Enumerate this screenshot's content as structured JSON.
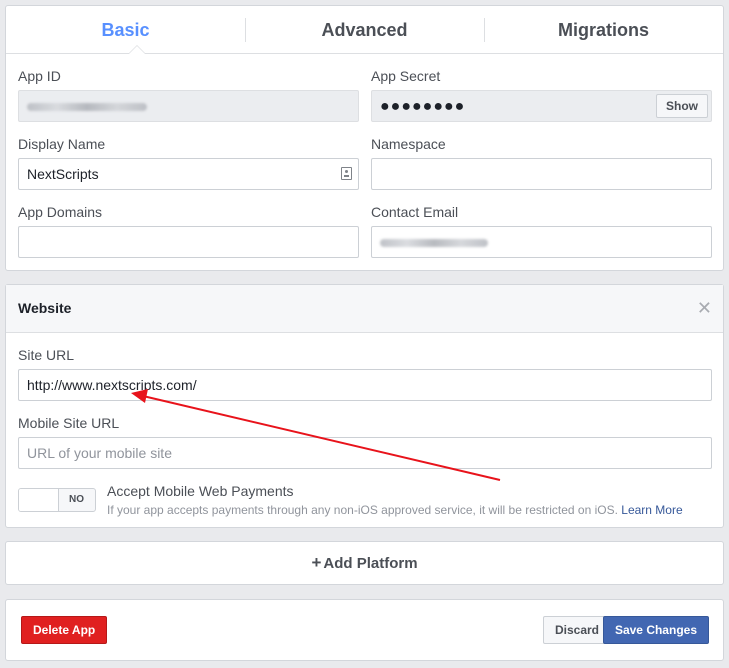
{
  "tabs": [
    {
      "label": "Basic",
      "active": true
    },
    {
      "label": "Advanced",
      "active": false
    },
    {
      "label": "Migrations",
      "active": false
    }
  ],
  "basic": {
    "app_id_label": "App ID",
    "app_secret_label": "App Secret",
    "app_secret_mask": "●●●●●●●●",
    "show_label": "Show",
    "display_name_label": "Display Name",
    "display_name_value": "NextScripts",
    "namespace_label": "Namespace",
    "namespace_value": "",
    "app_domains_label": "App Domains",
    "app_domains_value": "",
    "contact_email_label": "Contact Email"
  },
  "website": {
    "title": "Website",
    "close_icon": "close-icon",
    "site_url_label": "Site URL",
    "site_url_value": "http://www.nextscripts.com/",
    "mobile_site_url_label": "Mobile Site URL",
    "mobile_site_url_placeholder": "URL of your mobile site",
    "toggle_state": "NO",
    "payments_title": "Accept Mobile Web Payments",
    "payments_desc": "If your app accepts payments through any non-iOS approved service, it will be restricted on iOS.",
    "learn_more": "Learn More"
  },
  "platform": {
    "plus": "+",
    "label": "Add Platform"
  },
  "footer": {
    "delete_label": "Delete App",
    "discard_label": "Discard",
    "save_label": "Save Changes"
  },
  "colors": {
    "active_tab": "#5890ff",
    "delete": "#e02020",
    "save": "#4267b2",
    "annotation_arrow": "#e8131b"
  }
}
